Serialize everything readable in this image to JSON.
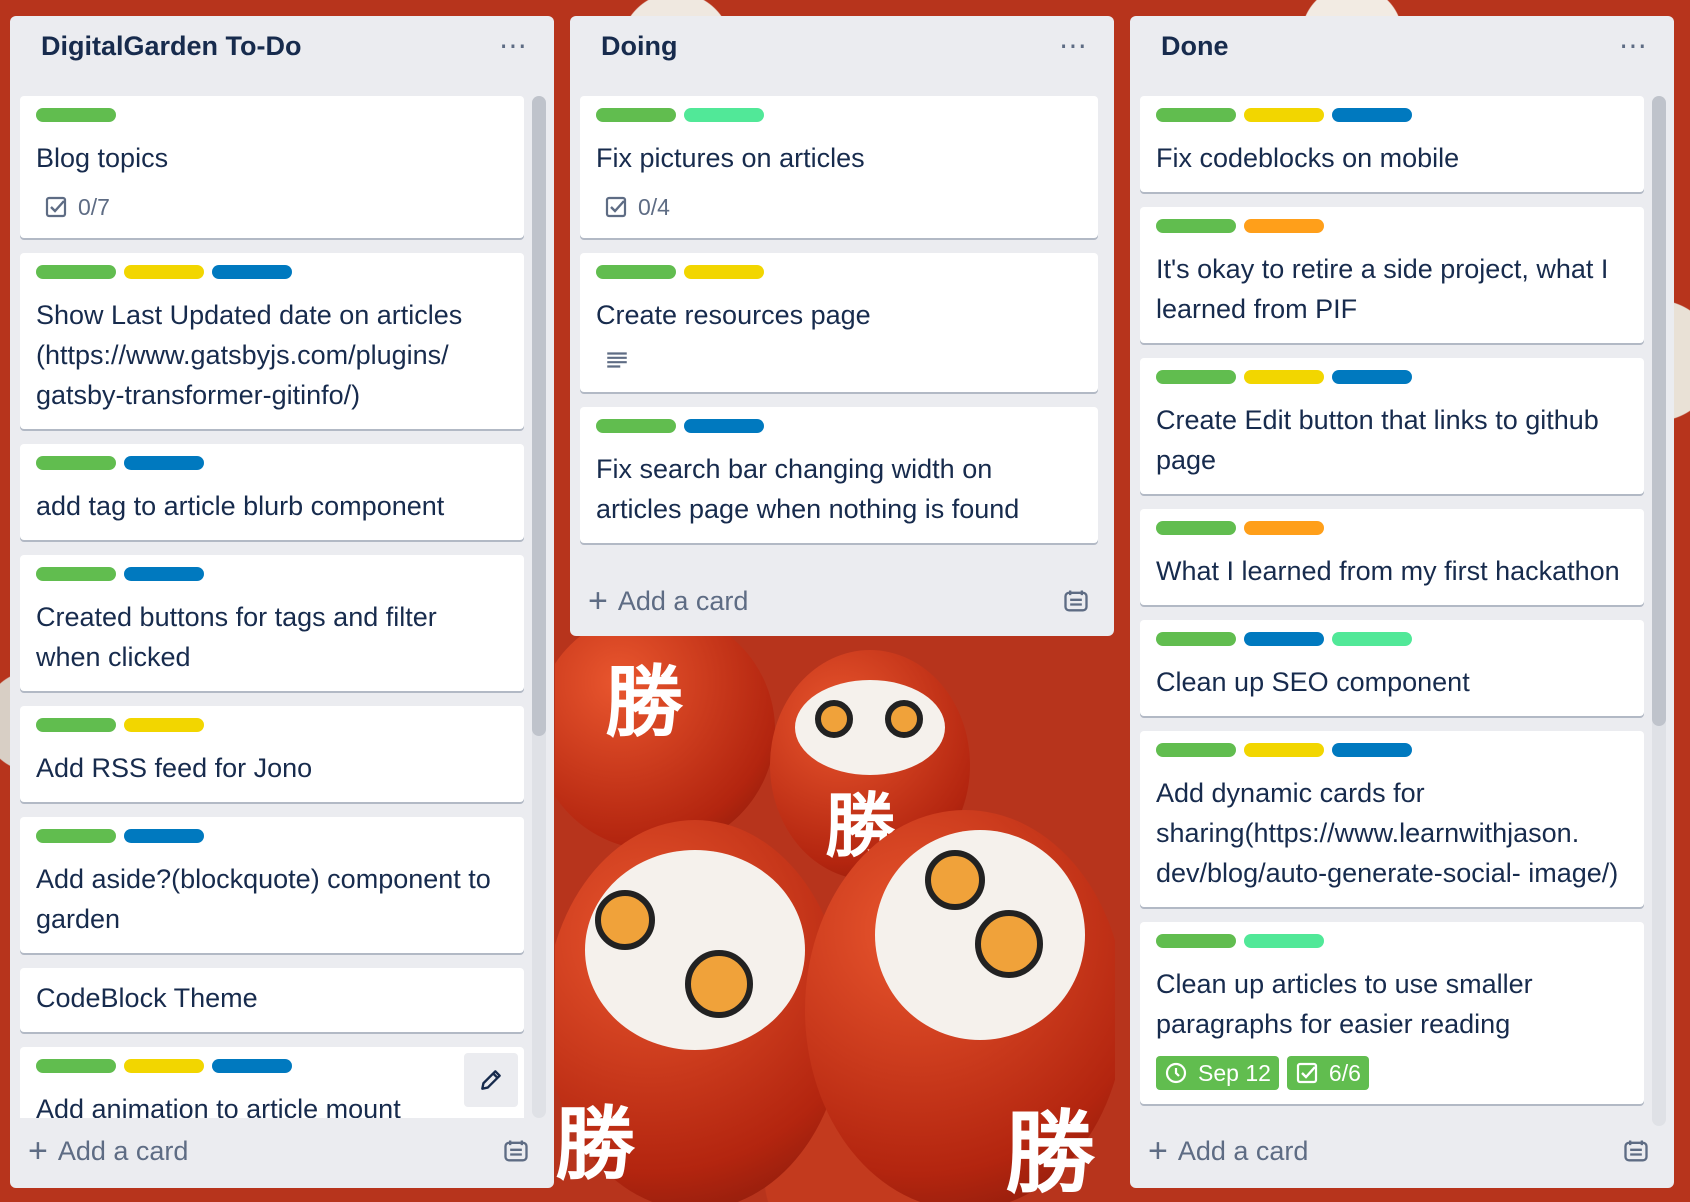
{
  "colors": {
    "green": "#61bd4f",
    "yellow": "#f2d600",
    "blue": "#0079bf",
    "orange": "#ff9f1a",
    "lime": "#51e898",
    "list_bg": "#ebecf0"
  },
  "lists": [
    {
      "title": "DigitalGarden To-Do",
      "more_icon": "more-horizontal-icon",
      "add_card_label": "Add a card",
      "cards": [
        {
          "labels": [
            "green"
          ],
          "title": "Blog topics",
          "checklist": "0/7"
        },
        {
          "labels": [
            "green",
            "yellow",
            "blue"
          ],
          "title": "Show Last Updated date on articles (https://www.gatsbyjs.com/plugins/ gatsby-transformer-gitinfo/)"
        },
        {
          "labels": [
            "green",
            "blue"
          ],
          "title": "add tag to article blurb component"
        },
        {
          "labels": [
            "green",
            "blue"
          ],
          "title": "Created buttons for tags and filter when clicked"
        },
        {
          "labels": [
            "green",
            "yellow"
          ],
          "title": "Add RSS feed for Jono"
        },
        {
          "labels": [
            "green",
            "blue"
          ],
          "title": "Add aside?(blockquote) component to garden"
        },
        {
          "labels": [],
          "title": "CodeBlock Theme"
        },
        {
          "labels": [
            "green",
            "yellow",
            "blue"
          ],
          "title": "Add animation to article mount",
          "hover_edit": true
        }
      ]
    },
    {
      "title": "Doing",
      "more_icon": "more-horizontal-icon",
      "add_card_label": "Add a card",
      "cards": [
        {
          "labels": [
            "green",
            "lime"
          ],
          "title": "Fix pictures on articles",
          "checklist": "0/4"
        },
        {
          "labels": [
            "green",
            "yellow"
          ],
          "title": "Create resources page",
          "description": true
        },
        {
          "labels": [
            "green",
            "blue"
          ],
          "title": "Fix search bar changing width on articles page when nothing is found"
        }
      ]
    },
    {
      "title": "Done",
      "more_icon": "more-horizontal-icon",
      "add_card_label": "Add a card",
      "cards": [
        {
          "labels": [
            "green",
            "yellow",
            "blue"
          ],
          "title": "Fix codeblocks on mobile"
        },
        {
          "labels": [
            "green",
            "orange"
          ],
          "title": "It's okay to retire a side project, what I learned from PIF"
        },
        {
          "labels": [
            "green",
            "yellow",
            "blue"
          ],
          "title": "Create Edit button that links to github page"
        },
        {
          "labels": [
            "green",
            "orange"
          ],
          "title": "What I learned from my first hackathon"
        },
        {
          "labels": [
            "green",
            "blue",
            "lime"
          ],
          "title": "Clean up SEO component"
        },
        {
          "labels": [
            "green",
            "yellow",
            "blue"
          ],
          "title": "Add dynamic cards for sharing(https://www.learnwithjason. dev/blog/auto-generate-social- image/)"
        },
        {
          "labels": [
            "green",
            "lime"
          ],
          "title": "Clean up articles to use smaller paragraphs for easier reading",
          "due": "Sep 12",
          "checklist_done": "6/6"
        }
      ]
    }
  ]
}
